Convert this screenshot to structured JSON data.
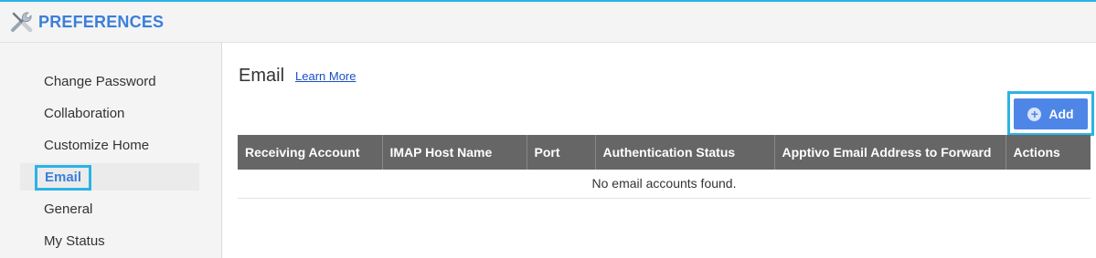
{
  "header": {
    "title": "PREFERENCES",
    "icon": "tools-icon"
  },
  "sidebar": {
    "items": [
      {
        "label": "Change Password"
      },
      {
        "label": "Collaboration"
      },
      {
        "label": "Customize Home"
      },
      {
        "label": "Email",
        "active": true
      },
      {
        "label": "General"
      },
      {
        "label": "My Status"
      }
    ]
  },
  "main": {
    "title": "Email",
    "learn_more": "Learn More",
    "add_label": "Add",
    "table": {
      "columns": [
        "Receiving Account",
        "IMAP Host Name",
        "Port",
        "Authentication Status",
        "Apptivo Email Address to Forward",
        "Actions"
      ],
      "empty_message": "No email accounts found."
    }
  },
  "colors": {
    "accent": "#3b7fd9",
    "highlight_border": "#2bb3e6",
    "header_bg": "#666666",
    "button_bg": "#4e86e8"
  }
}
